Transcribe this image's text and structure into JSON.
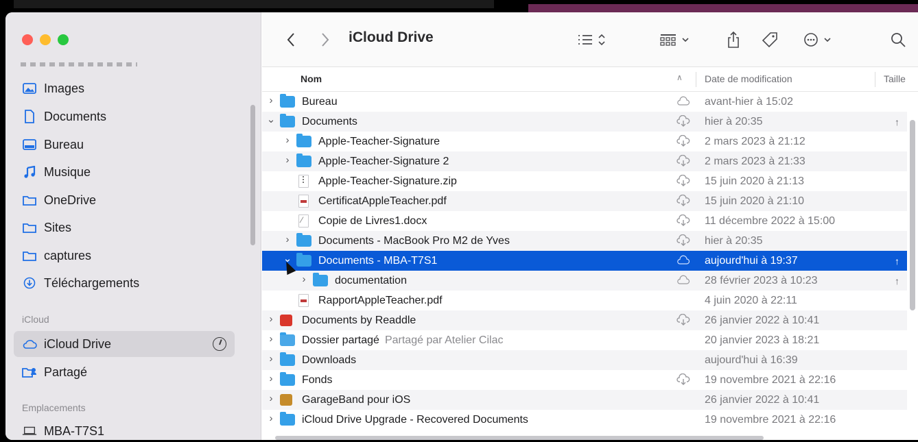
{
  "window": {
    "title": "iCloud Drive"
  },
  "sidebar": {
    "items": [
      {
        "label": "Images",
        "icon": "images-icon"
      },
      {
        "label": "Documents",
        "icon": "document-icon"
      },
      {
        "label": "Bureau",
        "icon": "desktop-icon"
      },
      {
        "label": "Musique",
        "icon": "music-note-icon"
      },
      {
        "label": "OneDrive",
        "icon": "folder-icon"
      },
      {
        "label": "Sites",
        "icon": "folder-icon"
      },
      {
        "label": "captures",
        "icon": "folder-icon"
      },
      {
        "label": "Téléchargements",
        "icon": "download-icon"
      }
    ],
    "icloud_section": "iCloud",
    "icloud_items": [
      {
        "label": "iCloud Drive",
        "icon": "cloud-icon",
        "selected": true
      },
      {
        "label": "Partagé",
        "icon": "shared-folder-icon"
      }
    ],
    "locations_section": "Emplacements",
    "location_items": [
      {
        "label": "MBA-T7S1",
        "icon": "laptop-icon"
      }
    ]
  },
  "toolbar": {
    "title": "iCloud Drive"
  },
  "columns": {
    "name": "Nom",
    "date": "Date de modification",
    "size": "Taille"
  },
  "files": [
    {
      "name": "Bureau",
      "kind": "folder",
      "level": 0,
      "chevron": "›",
      "cloud": "cloud-outline",
      "date": "avant-hier à 15:02",
      "arrow": ""
    },
    {
      "name": "Documents",
      "kind": "folder",
      "level": 0,
      "chevron": "⌄",
      "cloud": "cloud-download",
      "date": "hier à 20:35",
      "arrow": "↑"
    },
    {
      "name": "Apple-Teacher-Signature",
      "kind": "folder",
      "level": 1,
      "chevron": "›",
      "cloud": "cloud-download",
      "date": "2 mars 2023 à 21:12",
      "arrow": ""
    },
    {
      "name": "Apple-Teacher-Signature 2",
      "kind": "folder",
      "level": 1,
      "chevron": "›",
      "cloud": "cloud-download",
      "date": "2 mars 2023 à 21:33",
      "arrow": ""
    },
    {
      "name": "Apple-Teacher-Signature.zip",
      "kind": "zip",
      "level": 1,
      "chevron": "",
      "cloud": "cloud-download",
      "date": "15 juin 2020 à 21:13",
      "arrow": ""
    },
    {
      "name": "CertificatAppleTeacher.pdf",
      "kind": "pdf",
      "level": 1,
      "chevron": "",
      "cloud": "cloud-download",
      "date": "15 juin 2020 à 21:10",
      "arrow": ""
    },
    {
      "name": "Copie de Livres1.docx",
      "kind": "word",
      "level": 1,
      "chevron": "",
      "cloud": "cloud-download",
      "date": "11 décembre 2022 à 15:00",
      "arrow": ""
    },
    {
      "name": "Documents - MacBook Pro M2 de Yves",
      "kind": "folder",
      "level": 1,
      "chevron": "›",
      "cloud": "cloud-download",
      "date": "hier à 20:35",
      "arrow": ""
    },
    {
      "name": "Documents - MBA-T7S1",
      "kind": "folder",
      "level": 1,
      "chevron": "⌄",
      "cloud": "cloud-outline",
      "date": "aujourd'hui à 19:37",
      "arrow": "↑",
      "selected": true
    },
    {
      "name": "documentation",
      "kind": "folder",
      "level": 2,
      "chevron": "›",
      "cloud": "cloud-outline",
      "date": "28 février 2023 à 10:23",
      "arrow": "↑"
    },
    {
      "name": "RapportAppleTeacher.pdf",
      "kind": "pdf",
      "level": 1,
      "chevron": "",
      "cloud": "",
      "date": "4 juin 2020 à 22:11",
      "arrow": ""
    },
    {
      "name": "Documents by Readdle",
      "kind": "app-readdle",
      "level": 0,
      "chevron": "›",
      "cloud": "cloud-download",
      "date": "26 janvier 2022 à 10:41",
      "arrow": ""
    },
    {
      "name": "Dossier partagé",
      "kind": "folder-shared",
      "level": 0,
      "chevron": "›",
      "cloud": "",
      "date": "20 janvier 2023 à 18:21",
      "arrow": "",
      "shared": "Partagé par Atelier Cilac"
    },
    {
      "name": "Downloads",
      "kind": "folder",
      "level": 0,
      "chevron": "›",
      "cloud": "",
      "date": "aujourd'hui à 16:39",
      "arrow": ""
    },
    {
      "name": "Fonds",
      "kind": "folder",
      "level": 0,
      "chevron": "›",
      "cloud": "cloud-download",
      "date": "19 novembre 2021 à 22:16",
      "arrow": ""
    },
    {
      "name": "GarageBand pour iOS",
      "kind": "app-garageband",
      "level": 0,
      "chevron": "›",
      "cloud": "",
      "date": "26 janvier 2022 à 10:41",
      "arrow": ""
    },
    {
      "name": "iCloud Drive Upgrade - Recovered Documents",
      "kind": "folder",
      "level": 0,
      "chevron": "›",
      "cloud": "",
      "date": "19 novembre 2021 à 22:16",
      "arrow": ""
    }
  ],
  "colors": {
    "selection": "#0a5ad7",
    "folder": "#35a0e8",
    "sidebar_bg": "#e8e6ea"
  }
}
